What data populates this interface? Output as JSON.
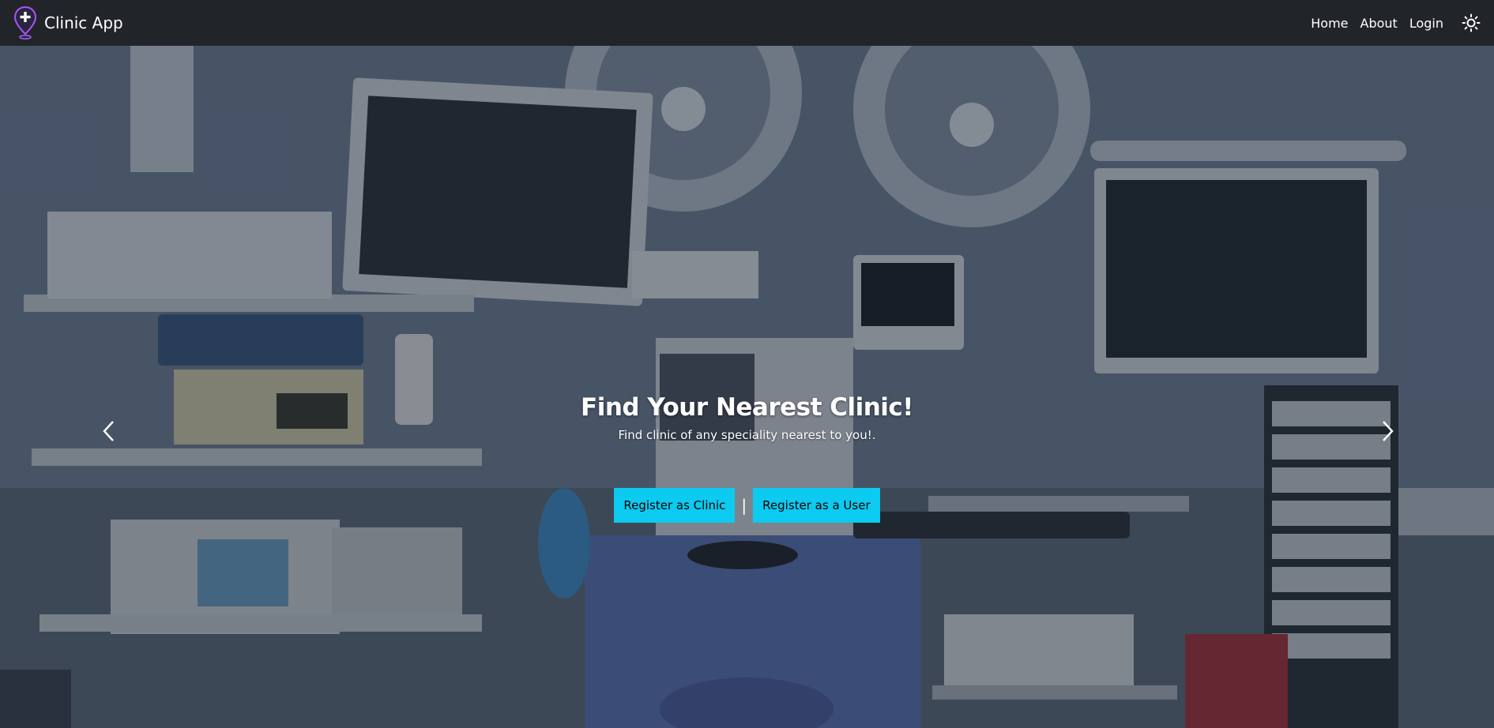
{
  "navbar": {
    "brand": "Clinic App",
    "links": {
      "home": "Home",
      "about": "About",
      "login": "Login"
    }
  },
  "hero": {
    "title": "Find Your Nearest Clinic!",
    "subtitle": "Find clinic of any speciality nearest to you!.",
    "buttons": {
      "register_clinic": "Register as Clinic",
      "separator": "|",
      "register_user": "Register as a User"
    }
  },
  "colors": {
    "navbar_bg": "#212529",
    "accent_button": "#0dcaf0",
    "logo_accent": "#a855f7"
  },
  "icons": {
    "brand": "location-pin-plus-icon",
    "theme": "sun-icon",
    "prev": "chevron-left-icon",
    "next": "chevron-right-icon"
  }
}
